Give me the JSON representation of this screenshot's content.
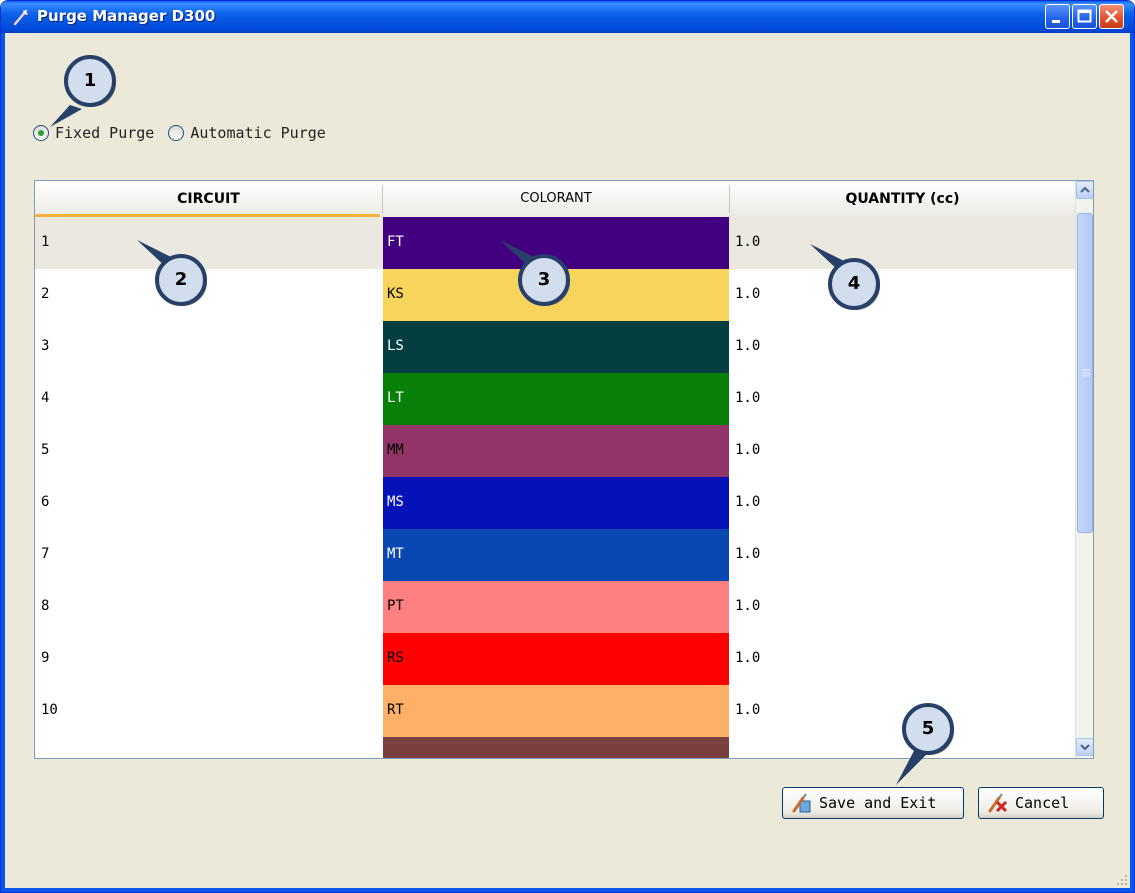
{
  "window": {
    "title": "Purge Manager D300"
  },
  "purge_mode": {
    "options": [
      {
        "label": "Fixed Purge",
        "selected": true
      },
      {
        "label": "Automatic Purge",
        "selected": false
      }
    ]
  },
  "table": {
    "columns": [
      "CIRCUIT",
      "COLORANT",
      "QUANTITY (cc)"
    ],
    "rows": [
      {
        "circuit": "1",
        "colorant": "FT",
        "quantity": "1.0",
        "color": "#420080",
        "text_color": "#ffffff"
      },
      {
        "circuit": "2",
        "colorant": "KS",
        "quantity": "1.0",
        "color": "#f7d45c",
        "text_color": "#000000"
      },
      {
        "circuit": "3",
        "colorant": "LS",
        "quantity": "1.0",
        "color": "#043e40",
        "text_color": "#ffffff"
      },
      {
        "circuit": "4",
        "colorant": "LT",
        "quantity": "1.0",
        "color": "#088008",
        "text_color": "#ffffff"
      },
      {
        "circuit": "5",
        "colorant": "MM",
        "quantity": "1.0",
        "color": "#923468",
        "text_color": "#000000"
      },
      {
        "circuit": "6",
        "colorant": "MS",
        "quantity": "1.0",
        "color": "#0412b8",
        "text_color": "#ffffff"
      },
      {
        "circuit": "7",
        "colorant": "MT",
        "quantity": "1.0",
        "color": "#0848b0",
        "text_color": "#ffffff"
      },
      {
        "circuit": "8",
        "colorant": "PT",
        "quantity": "1.0",
        "color": "#ff8080",
        "text_color": "#000000"
      },
      {
        "circuit": "9",
        "colorant": "RS",
        "quantity": "1.0",
        "color": "#fe0000",
        "text_color": "#000000"
      },
      {
        "circuit": "10",
        "colorant": "RT",
        "quantity": "1.0",
        "color": "#fdb068",
        "text_color": "#000000"
      },
      {
        "circuit": "",
        "colorant": "",
        "quantity": "",
        "color": "#7a4040",
        "text_color": "#000000"
      }
    ]
  },
  "buttons": {
    "save": "Save and Exit",
    "cancel": "Cancel"
  },
  "callouts": [
    "1",
    "2",
    "3",
    "4",
    "5"
  ],
  "colors": {
    "title_bar": "#0a56e8",
    "window_bg": "#ece9d8",
    "sort_indicator": "#f7b23b",
    "callout_fill": "#d2deed",
    "callout_ring": "#27406a"
  }
}
